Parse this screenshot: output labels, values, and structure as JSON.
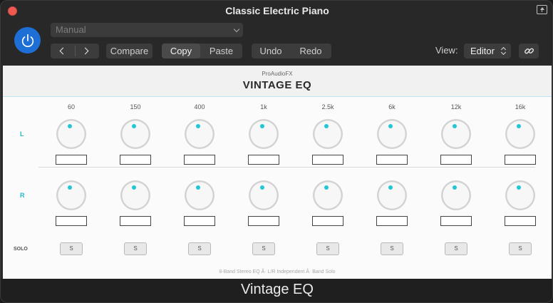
{
  "window": {
    "title": "Classic Electric Piano"
  },
  "toolbar": {
    "preset_value": "Manual",
    "compare_label": "Compare",
    "copy_label": "Copy",
    "paste_label": "Paste",
    "undo_label": "Undo",
    "redo_label": "Redo",
    "view_label": "View:",
    "view_value": "Editor"
  },
  "plugin": {
    "brand": "ProAudioFX",
    "product": "VINTAGE EQ",
    "bands": [
      "60",
      "150",
      "400",
      "1k",
      "2.5k",
      "6k",
      "12k",
      "16k"
    ],
    "row_labels": {
      "left": "L",
      "right": "R",
      "solo": "SOLO"
    },
    "solo_button_label": "S",
    "footer_note": "8-Band Stereo EQ  Â·  L/R Independent  Â·  Band Solo"
  },
  "bottom_bar": {
    "title": "Vintage EQ"
  },
  "colors": {
    "accent": "#21c7d6",
    "power": "#1d6fd6",
    "close": "#ee5a52"
  },
  "icons": [
    "close-icon",
    "expand-icon",
    "power-icon",
    "chevron-down-icon",
    "chevron-left-icon",
    "chevron-right-icon",
    "link-icon"
  ]
}
